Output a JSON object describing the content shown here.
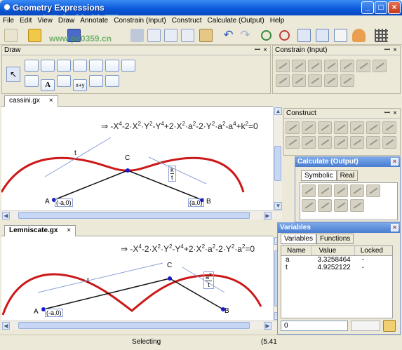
{
  "app": {
    "title": "Geometry Expressions"
  },
  "watermark": {
    "top": "河东软件园",
    "url": "www.pc0359.cn"
  },
  "menu": [
    "File",
    "Edit",
    "View",
    "Draw",
    "Annotate",
    "Constrain (Input)",
    "Construct",
    "Calculate (Output)",
    "Help"
  ],
  "panels": {
    "draw": "Draw",
    "constrain": "Constrain (Input)",
    "construct": "Construct",
    "calculate": "Calculate (Output)",
    "calc_tabs": [
      "Symbolic",
      "Real"
    ],
    "variables": "Variables",
    "var_tabs": [
      "Variables",
      "Functions"
    ],
    "var_columns": [
      "Name",
      "Value",
      "Locked"
    ],
    "var_rows": [
      {
        "name": "a",
        "value": "3.3258464",
        "locked": "-"
      },
      {
        "name": "t",
        "value": "4.9252122",
        "locked": "-"
      }
    ],
    "var_input_value": "0"
  },
  "docs": [
    {
      "tab": "cassini.gx",
      "labels": {
        "A": "A",
        "A_coord": "(-a,0)",
        "B": "B",
        "B_coord": "(a,0)",
        "C": "C",
        "t": "t",
        "k": "k",
        "kd": "t"
      }
    },
    {
      "tab": "Lemniscate.gx",
      "labels": {
        "A": "A",
        "A_coord": "(-a,0)",
        "B": "B",
        "C": "C",
        "t": "t",
        "frac_n": "a",
        "frac_exp": "2",
        "frac_d": "t"
      }
    }
  ],
  "status": {
    "text": "Selecting",
    "coord": "(5.41"
  },
  "tools": {
    "pin": "&#x2D4;"
  }
}
